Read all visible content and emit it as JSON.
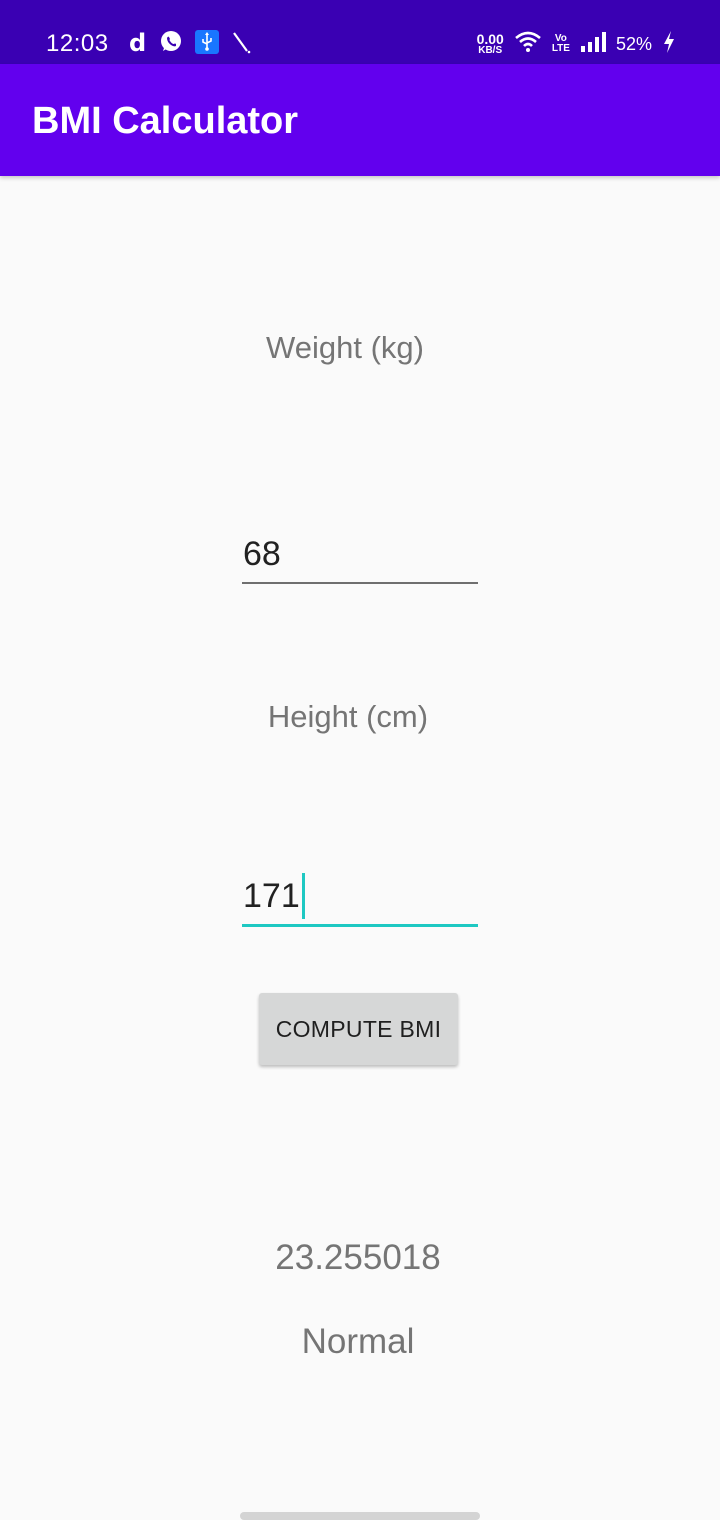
{
  "status_bar": {
    "time": "12:03",
    "left_icons": [
      "d-app-icon",
      "whatsapp-icon",
      "usb-icon",
      "pen-icon"
    ],
    "net_speed_value": "0.00",
    "net_speed_unit": "KB/S",
    "volte_top": "Vo",
    "volte_bottom": "LTE",
    "battery": "52%"
  },
  "app_bar": {
    "title": "BMI Calculator",
    "background": "#6200ee"
  },
  "form": {
    "weight_label": "Weight (kg)",
    "weight_value": "68",
    "height_label": "Height (cm)",
    "height_value": "171",
    "compute_label": "COMPUTE BMI"
  },
  "result": {
    "bmi_value": "23.255018",
    "category": "Normal"
  },
  "colors": {
    "status_bar": "#3a00b3",
    "accent": "#1ec8c2",
    "button": "#d6d7d7"
  }
}
